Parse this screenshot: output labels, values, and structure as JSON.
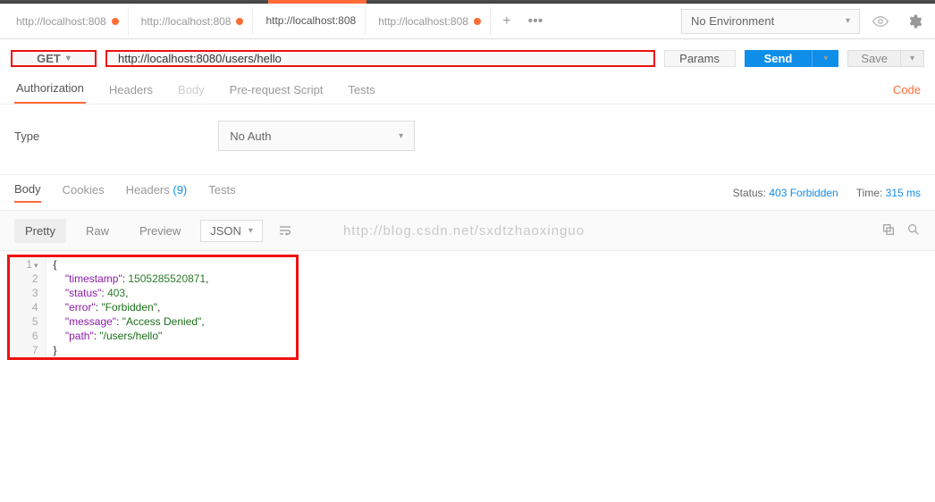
{
  "env": {
    "selected": "No Environment"
  },
  "tabs": [
    {
      "label": "http://localhost:808",
      "dirty": true,
      "active": false
    },
    {
      "label": "http://localhost:808",
      "dirty": true,
      "active": false
    },
    {
      "label": "http://localhost:808",
      "dirty": false,
      "active": true
    },
    {
      "label": "http://localhost:808",
      "dirty": true,
      "active": false
    }
  ],
  "request": {
    "method": "GET",
    "url": "http://localhost:8080/users/hello",
    "params_btn": "Params",
    "send": "Send",
    "save": "Save"
  },
  "req_tabs": {
    "authorization": "Authorization",
    "headers": "Headers",
    "body": "Body",
    "prerequest": "Pre-request Script",
    "tests": "Tests",
    "code": "Code"
  },
  "auth": {
    "type_label": "Type",
    "type_value": "No Auth"
  },
  "resp_tabs": {
    "body": "Body",
    "cookies": "Cookies",
    "headers": "Headers",
    "headers_count": "(9)",
    "tests": "Tests"
  },
  "status": {
    "label": "Status:",
    "value": "403 Forbidden"
  },
  "time": {
    "label": "Time:",
    "value": "315 ms"
  },
  "viewer": {
    "pretty": "Pretty",
    "raw": "Raw",
    "preview": "Preview",
    "format": "JSON",
    "watermark": "http://blog.csdn.net/sxdtzhaoxinguo"
  },
  "response_json": {
    "timestamp": 1505285520871,
    "status": 403,
    "error": "Forbidden",
    "message": "Access Denied",
    "path": "/users/hello"
  },
  "lines": [
    "1",
    "2",
    "3",
    "4",
    "5",
    "6",
    "7"
  ]
}
